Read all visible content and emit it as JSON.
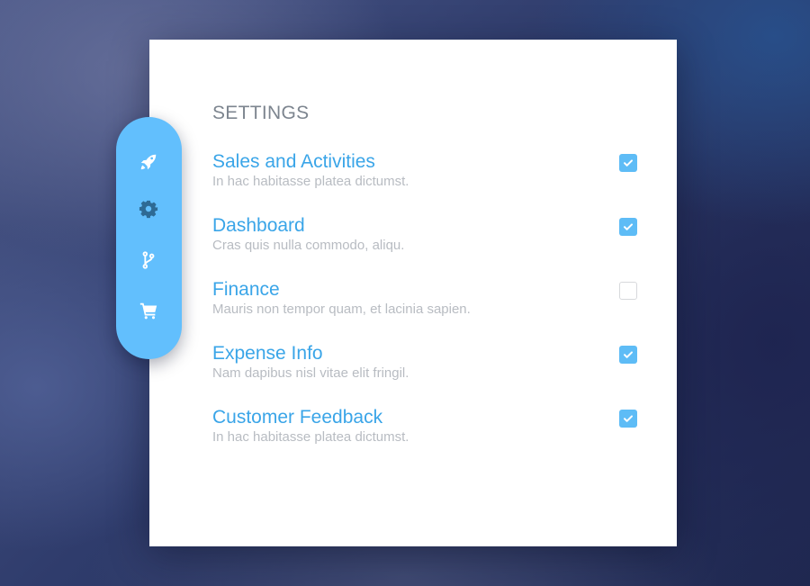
{
  "colors": {
    "accent": "#3aa5e8",
    "rail": "#62bffd",
    "checkbox_on": "#5ebcf6",
    "active_icon": "#2e6a94",
    "icon": "#ffffff"
  },
  "sidebar": {
    "items": [
      {
        "icon": "rocket-icon",
        "active": false
      },
      {
        "icon": "gear-icon",
        "active": true
      },
      {
        "icon": "git-branch-icon",
        "active": false
      },
      {
        "icon": "cart-icon",
        "active": false
      }
    ]
  },
  "settings": {
    "title": "SETTINGS",
    "items": [
      {
        "title": "Sales and Activities",
        "subtitle": "In hac habitasse platea dictumst.",
        "checked": true
      },
      {
        "title": "Dashboard",
        "subtitle": "Cras quis nulla commodo, aliqu.",
        "checked": true
      },
      {
        "title": "Finance",
        "subtitle": "Mauris non tempor quam, et lacinia sapien.",
        "checked": false
      },
      {
        "title": "Expense Info",
        "subtitle": "Nam dapibus nisl vitae elit fringil.",
        "checked": true
      },
      {
        "title": "Customer Feedback",
        "subtitle": "In hac habitasse platea dictumst.",
        "checked": true
      }
    ]
  }
}
